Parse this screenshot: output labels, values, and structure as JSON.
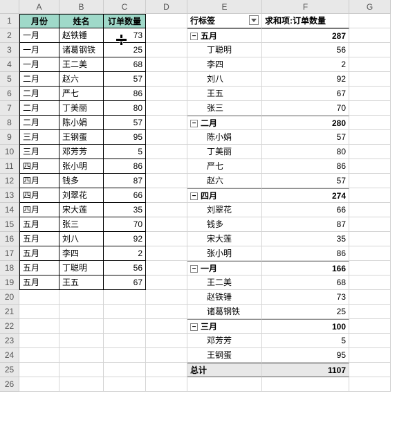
{
  "columns": [
    "A",
    "B",
    "C",
    "D",
    "E",
    "F",
    "G"
  ],
  "row_count": 26,
  "left_table": {
    "headers": [
      "月份",
      "姓名",
      "订单数量"
    ],
    "rows": [
      {
        "m": "一月",
        "n": "赵铁锤",
        "q": 73
      },
      {
        "m": "一月",
        "n": "诸葛钢铁",
        "q": 25
      },
      {
        "m": "一月",
        "n": "王二美",
        "q": 68
      },
      {
        "m": "二月",
        "n": "赵六",
        "q": 57
      },
      {
        "m": "二月",
        "n": "严七",
        "q": 86
      },
      {
        "m": "二月",
        "n": "丁美丽",
        "q": 80
      },
      {
        "m": "二月",
        "n": "陈小娟",
        "q": 57
      },
      {
        "m": "三月",
        "n": "王钢蛋",
        "q": 95
      },
      {
        "m": "三月",
        "n": "邓芳芳",
        "q": 5
      },
      {
        "m": "四月",
        "n": "张小明",
        "q": 86
      },
      {
        "m": "四月",
        "n": "钱多",
        "q": 87
      },
      {
        "m": "四月",
        "n": "刘翠花",
        "q": 66
      },
      {
        "m": "四月",
        "n": "宋大莲",
        "q": 35
      },
      {
        "m": "五月",
        "n": "张三",
        "q": 70
      },
      {
        "m": "五月",
        "n": "刘八",
        "q": 92
      },
      {
        "m": "五月",
        "n": "李四",
        "q": 2
      },
      {
        "m": "五月",
        "n": "丁聪明",
        "q": 56
      },
      {
        "m": "五月",
        "n": "王五",
        "q": 67
      }
    ]
  },
  "pivot": {
    "row_label": "行标签",
    "value_label": "求和项:订单数量",
    "collapse_glyph": "−",
    "groups": [
      {
        "name": "五月",
        "total": 287,
        "items": [
          {
            "n": "丁聪明",
            "v": 56
          },
          {
            "n": "李四",
            "v": 2
          },
          {
            "n": "刘八",
            "v": 92
          },
          {
            "n": "王五",
            "v": 67
          },
          {
            "n": "张三",
            "v": 70
          }
        ]
      },
      {
        "name": "二月",
        "total": 280,
        "items": [
          {
            "n": "陈小娟",
            "v": 57
          },
          {
            "n": "丁美丽",
            "v": 80
          },
          {
            "n": "严七",
            "v": 86
          },
          {
            "n": "赵六",
            "v": 57
          }
        ]
      },
      {
        "name": "四月",
        "total": 274,
        "items": [
          {
            "n": "刘翠花",
            "v": 66
          },
          {
            "n": "钱多",
            "v": 87
          },
          {
            "n": "宋大莲",
            "v": 35
          },
          {
            "n": "张小明",
            "v": 86
          }
        ]
      },
      {
        "name": "一月",
        "total": 166,
        "items": [
          {
            "n": "王二美",
            "v": 68
          },
          {
            "n": "赵铁锤",
            "v": 73
          },
          {
            "n": "诸葛钢铁",
            "v": 25
          }
        ]
      },
      {
        "name": "三月",
        "total": 100,
        "items": [
          {
            "n": "邓芳芳",
            "v": 5
          },
          {
            "n": "王钢蛋",
            "v": 95
          }
        ]
      }
    ],
    "grand_label": "总计",
    "grand_total": 1107
  }
}
